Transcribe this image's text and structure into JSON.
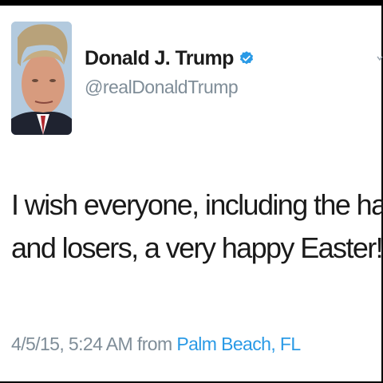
{
  "tweet": {
    "author": {
      "display_name": "Donald J. Trump",
      "handle": "@realDonaldTrump",
      "verified": true
    },
    "text_lines": [
      "I wish everyone, including the haters",
      "and losers, a very happy Easter!"
    ],
    "timestamp": "4/5/15, 5:24 AM",
    "from_label": "from",
    "location": "Palm Beach, FL"
  },
  "icons": {
    "verified": "verified-badge-icon",
    "caret": "chevron-down-icon"
  },
  "colors": {
    "text": "#1a1a1a",
    "secondary": "#7f8d98",
    "link": "#2a9ae6",
    "verified": "#2a9ae6"
  }
}
